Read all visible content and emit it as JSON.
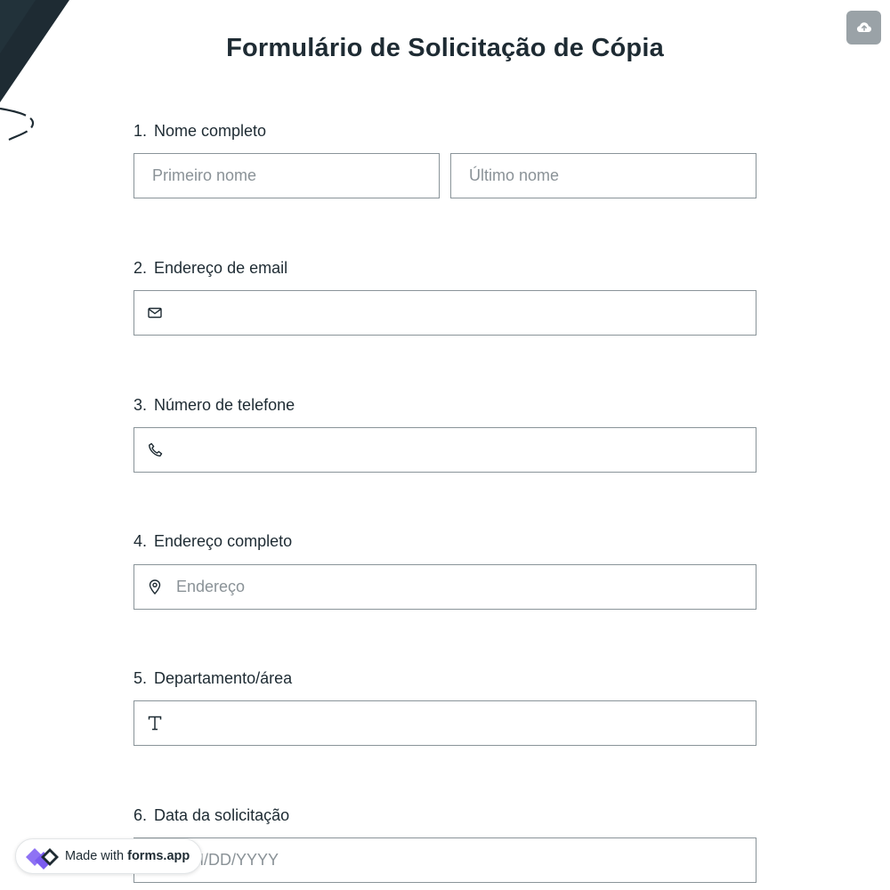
{
  "form": {
    "title": "Formulário de Solicitação de Cópia"
  },
  "questions": [
    {
      "number": "1.",
      "label": "Nome completo",
      "first_placeholder": "Primeiro nome",
      "last_placeholder": "Último nome"
    },
    {
      "number": "2.",
      "label": "Endereço de email",
      "icon": "envelope-icon",
      "placeholder": ""
    },
    {
      "number": "3.",
      "label": "Número de telefone",
      "icon": "phone-icon",
      "placeholder": ""
    },
    {
      "number": "4.",
      "label": "Endereço completo",
      "icon": "map-pin-icon",
      "placeholder": "Endereço"
    },
    {
      "number": "5.",
      "label": "Departamento/área",
      "icon": "text-icon",
      "placeholder": ""
    },
    {
      "number": "6.",
      "label": "Data da solicitação",
      "placeholder": "MM/DD/YYYY"
    }
  ],
  "badge": {
    "made_with": "Made with",
    "brand": "forms.app"
  },
  "toolbar": {
    "save_icon": "cloud-upload-icon"
  },
  "colors": {
    "text": "#1e2b33",
    "border": "#8a9499",
    "placeholder": "#8a9297",
    "save_button": "#9aa2a7",
    "logo_purple": "#7b5cf0",
    "deco_dark": "#1e2b33"
  }
}
